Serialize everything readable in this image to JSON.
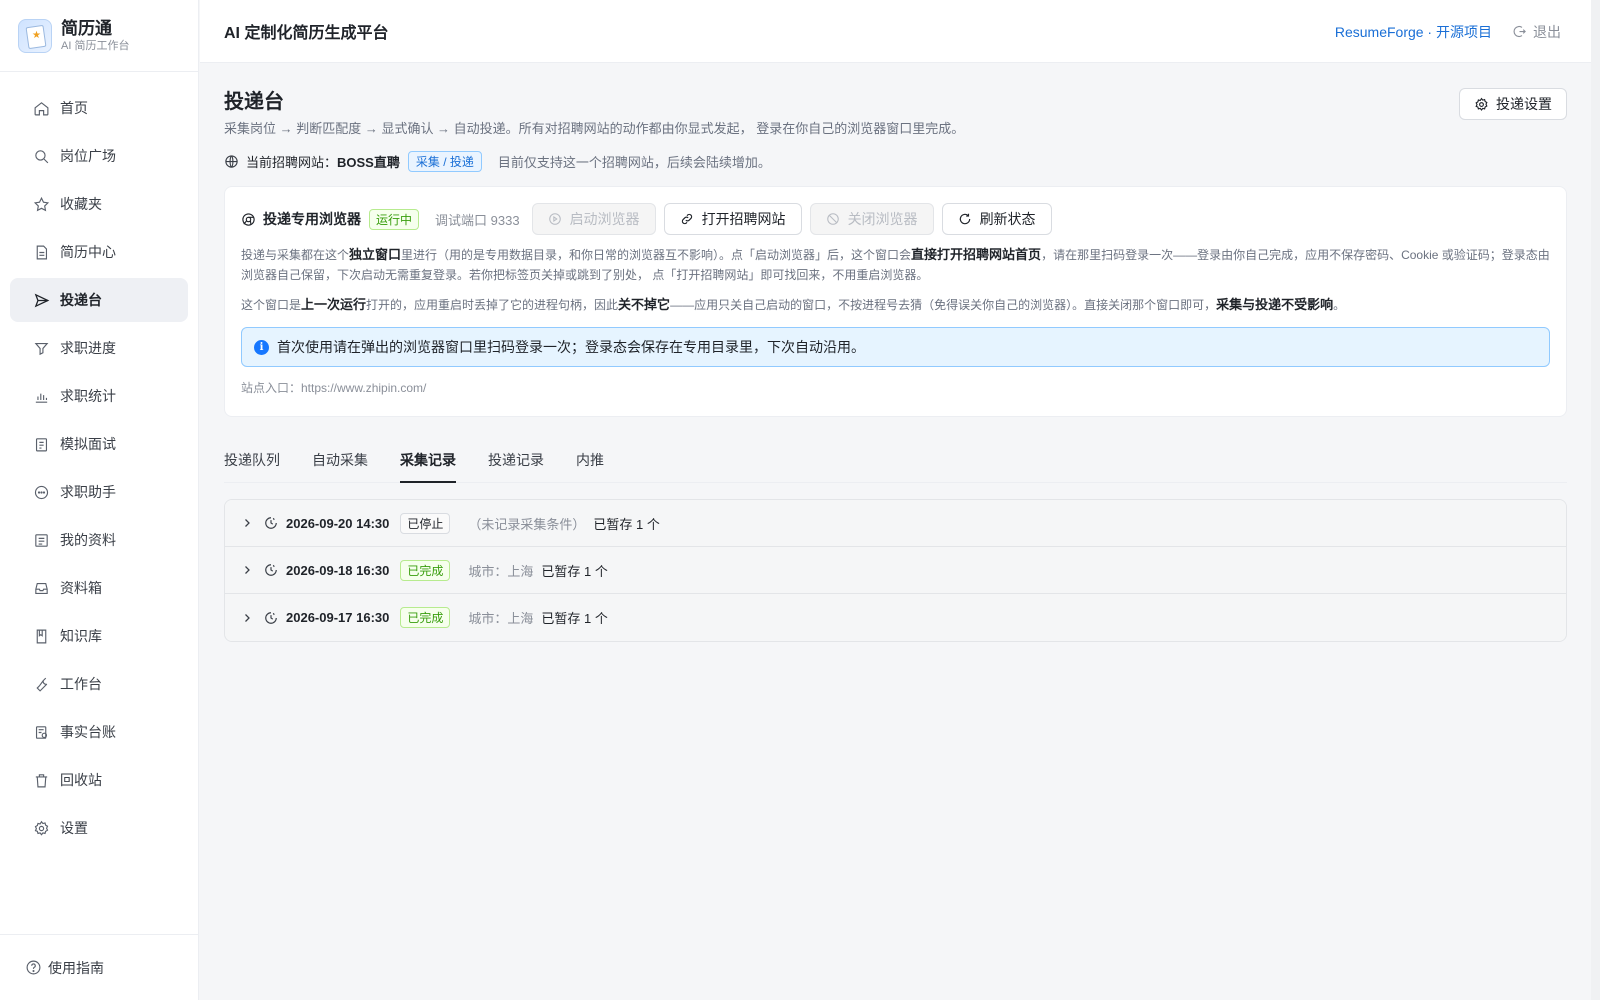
{
  "brand": {
    "title": "简历通",
    "subtitle": "AI 简历工作台"
  },
  "sidebar": {
    "items": [
      {
        "label": "首页",
        "icon": "home-icon"
      },
      {
        "label": "岗位广场",
        "icon": "search-icon"
      },
      {
        "label": "收藏夹",
        "icon": "star-icon"
      },
      {
        "label": "简历中心",
        "icon": "document-icon"
      },
      {
        "label": "投递台",
        "icon": "send-icon",
        "active": true
      },
      {
        "label": "求职进度",
        "icon": "filter-icon"
      },
      {
        "label": "求职统计",
        "icon": "bar-chart-icon"
      },
      {
        "label": "模拟面试",
        "icon": "clipboard-icon"
      },
      {
        "label": "求职助手",
        "icon": "chat-icon"
      },
      {
        "label": "我的资料",
        "icon": "list-icon"
      },
      {
        "label": "资料箱",
        "icon": "inbox-icon"
      },
      {
        "label": "知识库",
        "icon": "book-icon"
      },
      {
        "label": "工作台",
        "icon": "tool-icon"
      },
      {
        "label": "事实台账",
        "icon": "ledger-icon"
      },
      {
        "label": "回收站",
        "icon": "trash-icon"
      },
      {
        "label": "设置",
        "icon": "gear-icon"
      }
    ],
    "footer": {
      "label": "使用指南",
      "icon": "help-icon"
    }
  },
  "topbar": {
    "title": "AI 定制化简历生成平台",
    "link": "ResumeForge · 开源项目",
    "logout": "退出"
  },
  "page": {
    "title": "投递台",
    "description": "采集岗位 → 判断匹配度 → 显式确认 → 自动投递。所有对招聘网站的动作都由你显式发起， 登录在你自己的浏览器窗口里完成。",
    "settings_button": "投递设置",
    "site": {
      "label": "当前招聘网站：",
      "name": "BOSS直聘",
      "tag": "采集 / 投递",
      "note": "目前仅支持这一个招聘网站，后续会陆续增加。"
    }
  },
  "browser_card": {
    "title": "投递专用浏览器",
    "status": "运行中",
    "port": "调试端口 9333",
    "buttons": {
      "start": "启动浏览器",
      "open_site": "打开招聘网站",
      "close": "关闭浏览器",
      "refresh": "刷新状态"
    },
    "para1": {
      "t1": "投递与采集都在这个",
      "b1": "独立窗口",
      "t2": "里进行（用的是专用数据目录，和你日常的浏览器互不影响）。点「启动浏览器」后，这个窗口会",
      "b2": "直接打开招聘网站首页",
      "t3": "，请在那里扫码登录一次——登录由你自己完成，应用不保存密码、Cookie 或验证码；登录态由浏览器自己保留，下次启动无需重复登录。若你把标签页关掉或跳到了别处， 点「打开招聘网站」即可找回来，不用重启浏览器。"
    },
    "para2": {
      "t1": "这个窗口是",
      "b1": "上一次运行",
      "t2": "打开的，应用重启时丢掉了它的进程句柄，因此",
      "b2": "关不掉它",
      "t3": "——应用只关自己启动的窗口，不按进程号去猜（免得误关你自己的浏览器）。直接关闭那个窗口即可，",
      "b3": "采集与投递不受影响",
      "t4": "。"
    },
    "alert": "首次使用请在弹出的浏览器窗口里扫码登录一次；登录态会保存在专用目录里，下次自动沿用。",
    "site_entry": "站点入口：https://www.zhipin.com/"
  },
  "tabs": [
    {
      "label": "投递队列"
    },
    {
      "label": "自动采集"
    },
    {
      "label": "采集记录",
      "active": true
    },
    {
      "label": "投递记录"
    },
    {
      "label": "内推"
    }
  ],
  "records": [
    {
      "time": "2026-09-20 14:30",
      "status": "已停止",
      "status_type": "stopped",
      "condition": "（未记录采集条件）",
      "count": "已暂存 1 个"
    },
    {
      "time": "2026-09-18 16:30",
      "status": "已完成",
      "status_type": "done",
      "condition": "城市：上海",
      "count": "已暂存 1 个"
    },
    {
      "time": "2026-09-17 16:30",
      "status": "已完成",
      "status_type": "done",
      "condition": "城市：上海",
      "count": "已暂存 1 个"
    }
  ],
  "colors": {
    "accent": "#1a6fd6",
    "success": "#389e0d",
    "info_bg": "#e6f4ff"
  }
}
